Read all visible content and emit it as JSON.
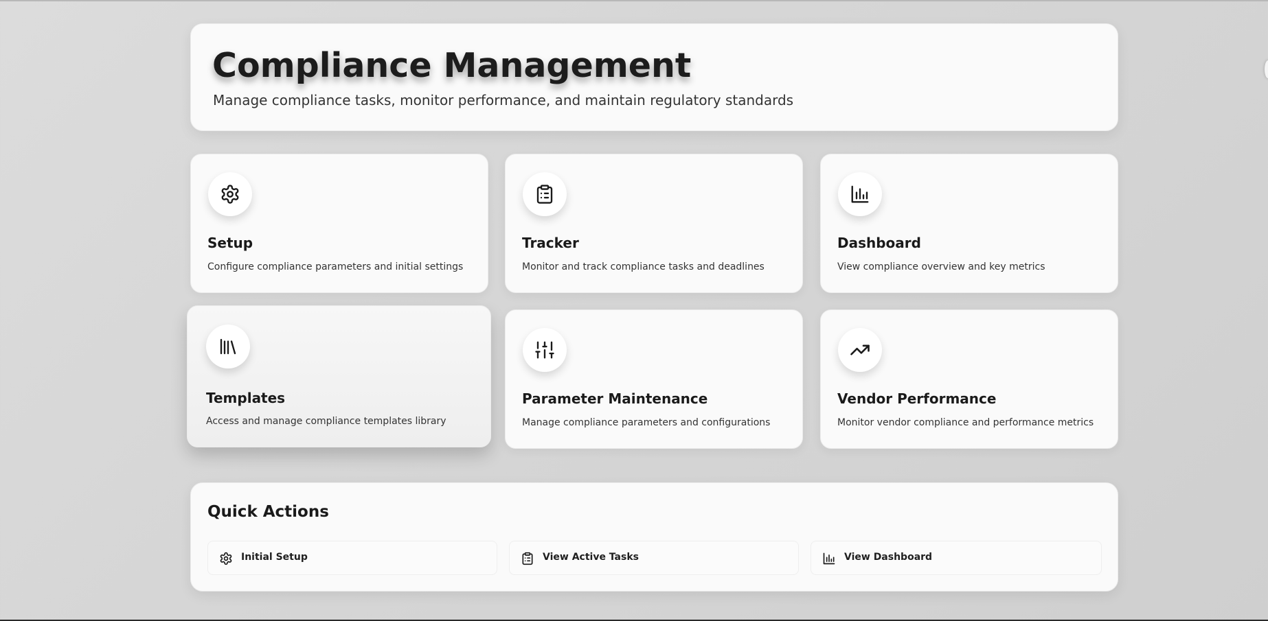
{
  "header": {
    "title": "Compliance Management",
    "subtitle": "Manage compliance tasks, monitor performance, and maintain regulatory standards"
  },
  "cards": [
    {
      "title": "Setup",
      "description": "Configure compliance parameters and initial settings",
      "icon": "gear-icon"
    },
    {
      "title": "Tracker",
      "description": "Monitor and track compliance tasks and deadlines",
      "icon": "clipboard-list-icon"
    },
    {
      "title": "Dashboard",
      "description": "View compliance overview and key metrics",
      "icon": "bar-chart-icon"
    },
    {
      "title": "Templates",
      "description": "Access and manage compliance templates library",
      "icon": "library-icon"
    },
    {
      "title": "Parameter Maintenance",
      "description": "Manage compliance parameters and configurations",
      "icon": "sliders-icon"
    },
    {
      "title": "Vendor Performance",
      "description": "Monitor vendor compliance and performance metrics",
      "icon": "trending-up-icon"
    }
  ],
  "quick_actions": {
    "title": "Quick Actions",
    "items": [
      {
        "label": "Initial Setup",
        "icon": "gear-icon"
      },
      {
        "label": "View Active Tasks",
        "icon": "clipboard-list-icon"
      },
      {
        "label": "View Dashboard",
        "icon": "bar-chart-icon"
      }
    ]
  }
}
